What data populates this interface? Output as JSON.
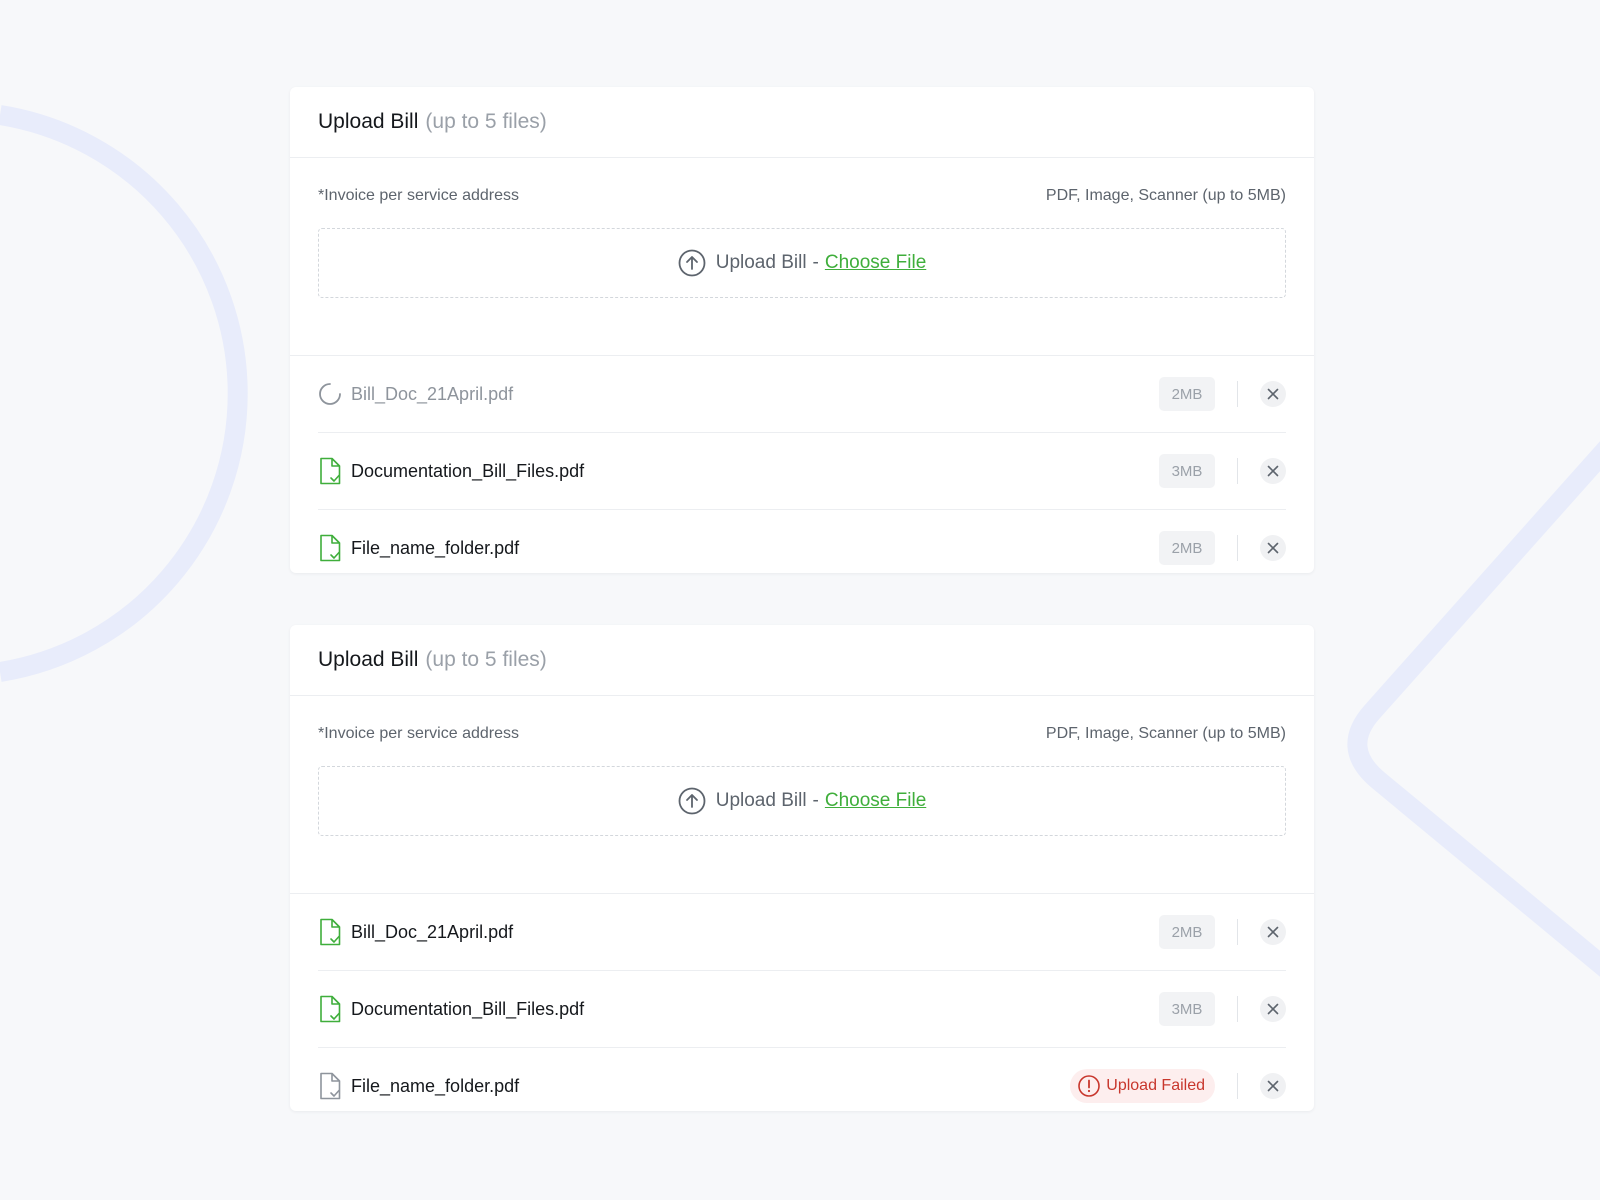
{
  "colors": {
    "background": "#f7f8fa",
    "card": "#ffffff",
    "accent_green": "#3fae3b",
    "error_red": "#c8372d",
    "decoration": "#e8ecfb"
  },
  "cards": [
    {
      "title": "Upload Bill",
      "subtitle": "(up to 5 files)",
      "note": "*Invoice per service address",
      "formats": "PDF, Image, Scanner (up to 5MB)",
      "dropzone": {
        "label": "Upload Bill",
        "separator": "-",
        "link": "Choose File",
        "icon": "upload-arrow-icon"
      },
      "files": [
        {
          "name": "Bill_Doc_21April.pdf",
          "status": "uploading",
          "size": "2MB",
          "icon": "spinner-icon"
        },
        {
          "name": "Documentation_Bill_Files.pdf",
          "status": "uploaded",
          "size": "3MB",
          "icon": "file-check-icon"
        },
        {
          "name": "File_name_folder.pdf",
          "status": "uploaded",
          "size": "2MB",
          "icon": "file-check-icon"
        }
      ]
    },
    {
      "title": "Upload Bill",
      "subtitle": "(up to 5 files)",
      "note": "*Invoice per service address",
      "formats": "PDF, Image, Scanner (up to 5MB)",
      "dropzone": {
        "label": "Upload Bill",
        "separator": "-",
        "link": "Choose File",
        "icon": "upload-arrow-icon"
      },
      "files": [
        {
          "name": "Bill_Doc_21April.pdf",
          "status": "uploaded",
          "size": "2MB",
          "icon": "file-check-icon"
        },
        {
          "name": "Documentation_Bill_Files.pdf",
          "status": "uploaded",
          "size": "3MB",
          "icon": "file-check-icon"
        },
        {
          "name": "File_name_folder.pdf",
          "status": "failed",
          "error": "Upload Failed",
          "icon": "file-check-gray-icon"
        }
      ]
    }
  ]
}
